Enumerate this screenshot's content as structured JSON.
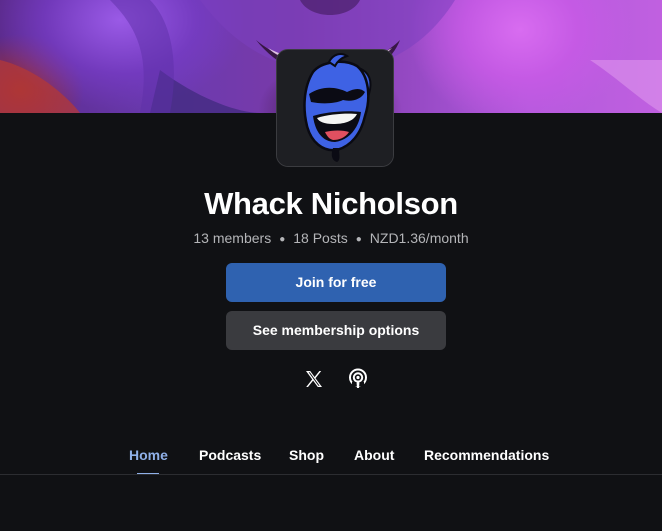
{
  "publication": {
    "name": "Whack Nicholson",
    "stats": {
      "members": "13 members",
      "posts": "18 Posts",
      "price": "NZD1.36/month"
    }
  },
  "buttons": {
    "join_label": "Join for free",
    "options_label": "See membership options"
  },
  "social": [
    {
      "icon": "x-twitter-icon"
    },
    {
      "icon": "podcast-icon"
    }
  ],
  "nav": {
    "tabs": [
      {
        "label": "Home",
        "active": true
      },
      {
        "label": "Podcasts",
        "active": false
      },
      {
        "label": "Shop",
        "active": false
      },
      {
        "label": "About",
        "active": false
      },
      {
        "label": "Recommendations",
        "active": false
      }
    ]
  },
  "colors": {
    "background": "#101114",
    "primary_button": "#2f62b0",
    "secondary_button": "#3a3b3f",
    "active_tab": "#8fb0e8"
  }
}
